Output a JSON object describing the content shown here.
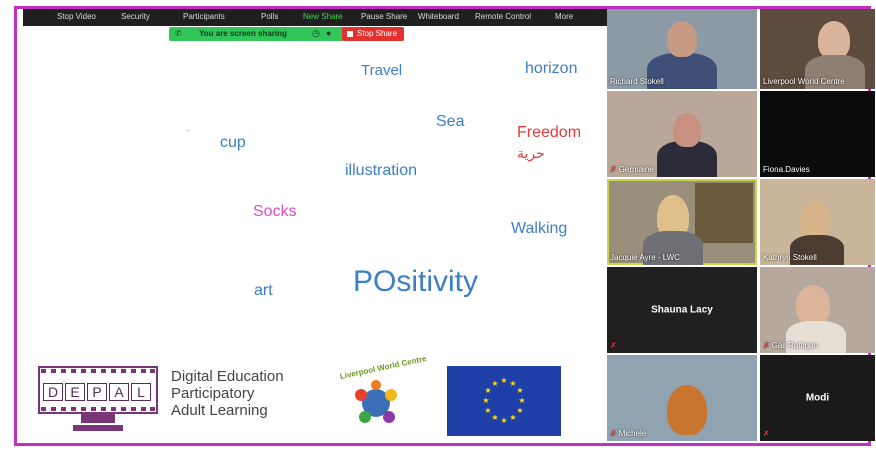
{
  "toolbar": {
    "items": [
      "Stop Video",
      "Security",
      "Participants",
      "Polls",
      "New Share",
      "Pause Share",
      "Whiteboard",
      "Remote Control",
      "More"
    ]
  },
  "sharing": {
    "banner": "You are screen sharing",
    "stop": "Stop Share"
  },
  "wordcloud": [
    {
      "text": "Travel",
      "color": "#3d7fc4"
    },
    {
      "text": "horizon",
      "color": "#3d7fc4"
    },
    {
      "text": "Sea",
      "color": "#3d7fc4"
    },
    {
      "text": "Freedom",
      "color": "#e23a3a"
    },
    {
      "text": "حرية",
      "color": "#e23a3a"
    },
    {
      "text": "cup",
      "color": "#3d7fc4"
    },
    {
      "text": "illustration",
      "color": "#3d7fc4"
    },
    {
      "text": "Socks",
      "color": "#d94fc6"
    },
    {
      "text": "Walking",
      "color": "#3d7fc4"
    },
    {
      "text": "art",
      "color": "#3d7fc4"
    },
    {
      "text": "POsitivity",
      "color": "#3d7fc4"
    }
  ],
  "logos": {
    "depal_letters": [
      "D",
      "E",
      "P",
      "A",
      "L"
    ],
    "depal_text": [
      "Digital Education",
      "Participatory",
      "Adult Learning"
    ],
    "lwc_text": "Liverpool World Centre"
  },
  "participants": [
    {
      "name": "Richard Stokell",
      "muted": false
    },
    {
      "name": "Liverpool World Centre",
      "muted": false
    },
    {
      "name": "Germaine",
      "muted": true
    },
    {
      "name": "Fiona.Davies",
      "muted": false
    },
    {
      "name": "Jacquie Ayre - LWC",
      "muted": false
    },
    {
      "name": "Kathryn Stokell",
      "muted": false
    },
    {
      "name": "Shauna Lacy",
      "muted": true
    },
    {
      "name": "Gail Rattigan",
      "muted": true
    },
    {
      "name": "Michele",
      "muted": true
    },
    {
      "name": "Modi",
      "muted": true
    }
  ],
  "colors": {
    "frame": "#c02fbf",
    "share_green": "#32c55a",
    "stop_red": "#e2312f",
    "active_speaker": "#c8d64a"
  }
}
